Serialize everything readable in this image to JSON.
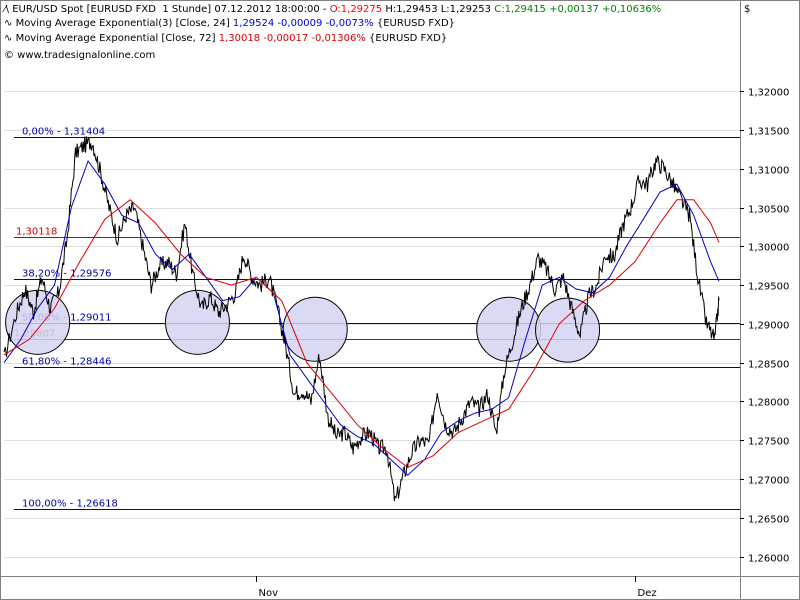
{
  "header": {
    "line1": {
      "prefix": "EUR/USD Spot [EURUSD FXD  1 Stunde] 07.12.2012 18:00:00 - ",
      "open": "O:1,29275",
      "hl": " H:1,29453 L:1,29253 ",
      "close": "C:1,29415 +0,00137 +0,10636%"
    },
    "line2": {
      "prefix": "Moving Average Exponential(3) [Close, 24] ",
      "value": "1,29524 -0,00009 -0,0073%",
      "suffix": " {EURUSD FXD}"
    },
    "line3": {
      "prefix": "Moving Average Exponential [Close, 72] ",
      "value": "1,30018 -0,00017 -0,01306%",
      "suffix": " {EURUSD FXD}"
    },
    "line4": "© www.tradesignalonline.com",
    "currency_symbol": "$"
  },
  "colors": {
    "price": "#000000",
    "ema24": "#0000cc",
    "ema72": "#dd0000",
    "fib_line": "#0000aa",
    "sr_line": "#cc0000",
    "circle_fill": "#d3d3f2",
    "circle_stroke": "#000000",
    "grid": "#c0c0c0",
    "open_text": "#ff0000",
    "close_text": "#008000"
  },
  "chart_data": {
    "type": "line",
    "title": "EUR/USD Spot [EURUSD FXD  1 Stunde]",
    "y_axis": {
      "side": "right",
      "ylim": [
        1.2575,
        1.3235
      ],
      "ticks": [
        "1,32000",
        "1,31500",
        "1,31000",
        "1,30500",
        "1,30000",
        "1,29500",
        "1,29000",
        "1,28500",
        "1,28000",
        "1,27500",
        "1,27000",
        "1,26500",
        "1,26000"
      ],
      "tick_values": [
        1.32,
        1.315,
        1.31,
        1.305,
        1.3,
        1.295,
        1.29,
        1.285,
        1.28,
        1.275,
        1.27,
        1.265,
        1.26
      ],
      "grid": true
    },
    "x_axis": {
      "xlim": [
        0,
        175
      ],
      "labels": [
        {
          "text": "Nov",
          "x": 60
        },
        {
          "text": "Dez",
          "x": 150
        }
      ]
    },
    "series": [
      {
        "name": "EUR/USD Spot",
        "x": [
          0,
          3,
          5,
          7,
          9,
          11,
          13,
          15,
          17,
          19,
          21,
          23,
          25,
          27,
          29,
          31,
          33,
          35,
          37,
          39,
          41,
          43,
          45,
          47,
          49,
          51,
          53,
          55,
          57,
          59,
          61,
          63,
          65,
          67,
          69,
          71,
          73,
          75,
          77,
          79,
          81,
          83,
          85,
          87,
          89,
          91,
          93,
          95,
          97,
          99,
          101,
          103,
          105,
          107,
          109,
          111,
          113,
          115,
          117,
          119,
          121,
          123,
          125,
          127,
          129,
          131,
          133,
          135,
          137,
          139,
          141,
          143,
          145,
          147,
          149,
          151,
          153,
          155,
          157,
          159,
          161,
          163,
          165,
          167,
          169,
          170
        ],
        "values": [
          1.2855,
          1.2915,
          1.2945,
          1.2915,
          1.296,
          1.292,
          1.294,
          1.301,
          1.312,
          1.313,
          1.3135,
          1.3095,
          1.305,
          1.301,
          1.304,
          1.305,
          1.3,
          1.295,
          1.2975,
          1.298,
          1.2965,
          1.303,
          1.296,
          1.292,
          1.2935,
          1.2915,
          1.2925,
          1.294,
          1.299,
          1.296,
          1.295,
          1.296,
          1.292,
          1.287,
          1.281,
          1.2815,
          1.28,
          1.286,
          1.278,
          1.2755,
          1.276,
          1.274,
          1.2755,
          1.276,
          1.274,
          1.274,
          1.267,
          1.2705,
          1.2735,
          1.275,
          1.2745,
          1.2815,
          1.277,
          1.276,
          1.278,
          1.28,
          1.279,
          1.281,
          1.276,
          1.284,
          1.288,
          1.292,
          1.295,
          1.2985,
          1.297,
          1.2945,
          1.296,
          1.292,
          1.2885,
          1.2935,
          1.295,
          1.299,
          1.2985,
          1.3025,
          1.305,
          1.3085,
          1.308,
          1.311,
          1.31,
          1.308,
          1.306,
          1.304,
          1.296,
          1.29,
          1.288,
          1.293
        ]
      },
      {
        "name": "Moving Average Exponential(3) [Close, 24]",
        "x": [
          0,
          4,
          8,
          12,
          16,
          20,
          24,
          28,
          32,
          36,
          40,
          44,
          48,
          52,
          56,
          60,
          64,
          68,
          72,
          76,
          80,
          84,
          88,
          92,
          96,
          100,
          104,
          108,
          112,
          116,
          120,
          124,
          128,
          132,
          136,
          140,
          144,
          148,
          152,
          156,
          160,
          164,
          168,
          170
        ],
        "values": [
          1.285,
          1.288,
          1.292,
          1.295,
          1.305,
          1.311,
          1.308,
          1.304,
          1.303,
          1.299,
          1.297,
          1.299,
          1.296,
          1.293,
          1.2935,
          1.296,
          1.294,
          1.286,
          1.283,
          1.28,
          1.277,
          1.2755,
          1.2745,
          1.2725,
          1.2705,
          1.2725,
          1.276,
          1.2775,
          1.2785,
          1.279,
          1.2805,
          1.288,
          1.295,
          1.296,
          1.2945,
          1.294,
          1.296,
          1.3,
          1.3035,
          1.307,
          1.308,
          1.304,
          1.298,
          1.2955
        ]
      },
      {
        "name": "Moving Average Exponential [Close, 72]",
        "x": [
          0,
          6,
          12,
          18,
          24,
          30,
          36,
          42,
          48,
          54,
          60,
          66,
          72,
          78,
          84,
          90,
          96,
          102,
          108,
          114,
          120,
          126,
          132,
          138,
          144,
          150,
          156,
          160,
          164,
          168,
          170
        ],
        "values": [
          1.286,
          1.288,
          1.292,
          1.298,
          1.3035,
          1.306,
          1.303,
          1.299,
          1.296,
          1.295,
          1.296,
          1.293,
          1.285,
          1.281,
          1.277,
          1.274,
          1.2715,
          1.273,
          1.276,
          1.2775,
          1.279,
          1.284,
          1.29,
          1.293,
          1.295,
          1.298,
          1.303,
          1.306,
          1.306,
          1.303,
          1.3005
        ]
      }
    ],
    "horizontal_lines": [
      {
        "label": "0,00% - 1,31404",
        "value": 1.31404,
        "color": "blue",
        "labeled": true
      },
      {
        "label": "1,30118",
        "value": 1.30118,
        "color": "red",
        "labeled": true
      },
      {
        "label": "38,20% - 1,29576",
        "value": 1.29576,
        "color": "blue",
        "labeled": true
      },
      {
        "label": "50,00% - 1,29011",
        "value": 1.29011,
        "color": "blue",
        "labeled": true
      },
      {
        "label": "1,28807",
        "value": 1.28807,
        "color": "red",
        "labeled": true
      },
      {
        "label": "61,80% - 1,28446",
        "value": 1.28446,
        "color": "blue",
        "labeled": true
      },
      {
        "label": "100,00% - 1,26618",
        "value": 1.26618,
        "color": "blue",
        "labeled": true
      }
    ],
    "circles": [
      {
        "x": 8,
        "value": 1.2902
      },
      {
        "x": 46,
        "value": 1.2902
      },
      {
        "x": 74,
        "value": 1.2893
      },
      {
        "x": 120,
        "value": 1.2893
      },
      {
        "x": 134,
        "value": 1.2892
      }
    ]
  }
}
